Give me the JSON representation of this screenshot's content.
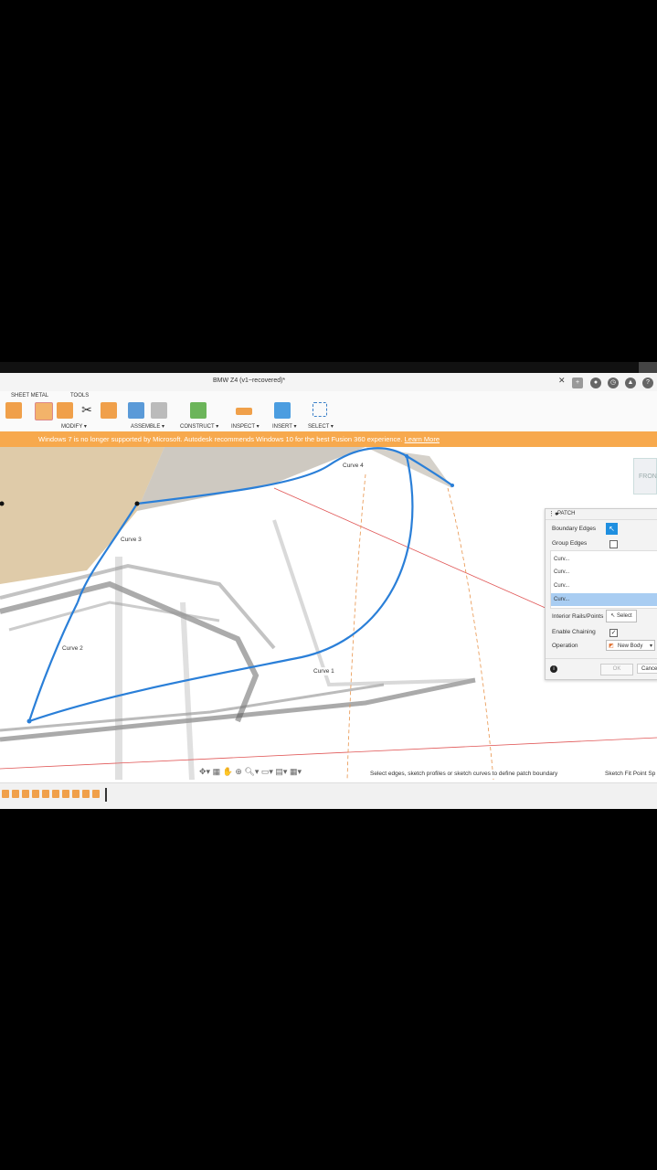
{
  "app": {
    "doc_title": "BMW Z4 (v1~recovered)*"
  },
  "ribbon": {
    "tabs": [
      "SHEET METAL",
      "TOOLS"
    ],
    "groups": [
      {
        "label": "MODIFY ▾"
      },
      {
        "label": "ASSEMBLE ▾"
      },
      {
        "label": "CONSTRUCT ▾"
      },
      {
        "label": "INSPECT ▾"
      },
      {
        "label": "INSERT ▾"
      },
      {
        "label": "SELECT ▾"
      }
    ]
  },
  "banner": {
    "text": "Windows 7 is no longer supported by Microsoft. Autodesk recommends Windows 10 for the best Fusion 360 experience.",
    "link": "Learn More"
  },
  "viewport": {
    "curve_labels": [
      "Curve 4",
      "Curve 3",
      "Curve 2",
      "Curve 1"
    ],
    "viewcube_label": "FRONT"
  },
  "patch_panel": {
    "title": "PATCH",
    "boundary_edges_label": "Boundary Edges",
    "group_edges_label": "Group Edges",
    "curve_items": [
      "Curv...",
      "Curv...",
      "Curv...",
      "Curv..."
    ],
    "interior_rails_label": "Interior Rails/Points",
    "select_label": "Select",
    "enable_chaining_label": "Enable Chaining",
    "operation_label": "Operation",
    "operation_value": "New Body",
    "ok_label": "OK",
    "cancel_label": "Cancel"
  },
  "status": {
    "hint": "Select edges, sketch profiles or sketch curves to define patch boundary",
    "right_text": "Sketch Fit Point Sp"
  },
  "colors": {
    "accent": "#1f8fe0",
    "banner": "#f7a94d",
    "curve": "#2a7fd8"
  }
}
